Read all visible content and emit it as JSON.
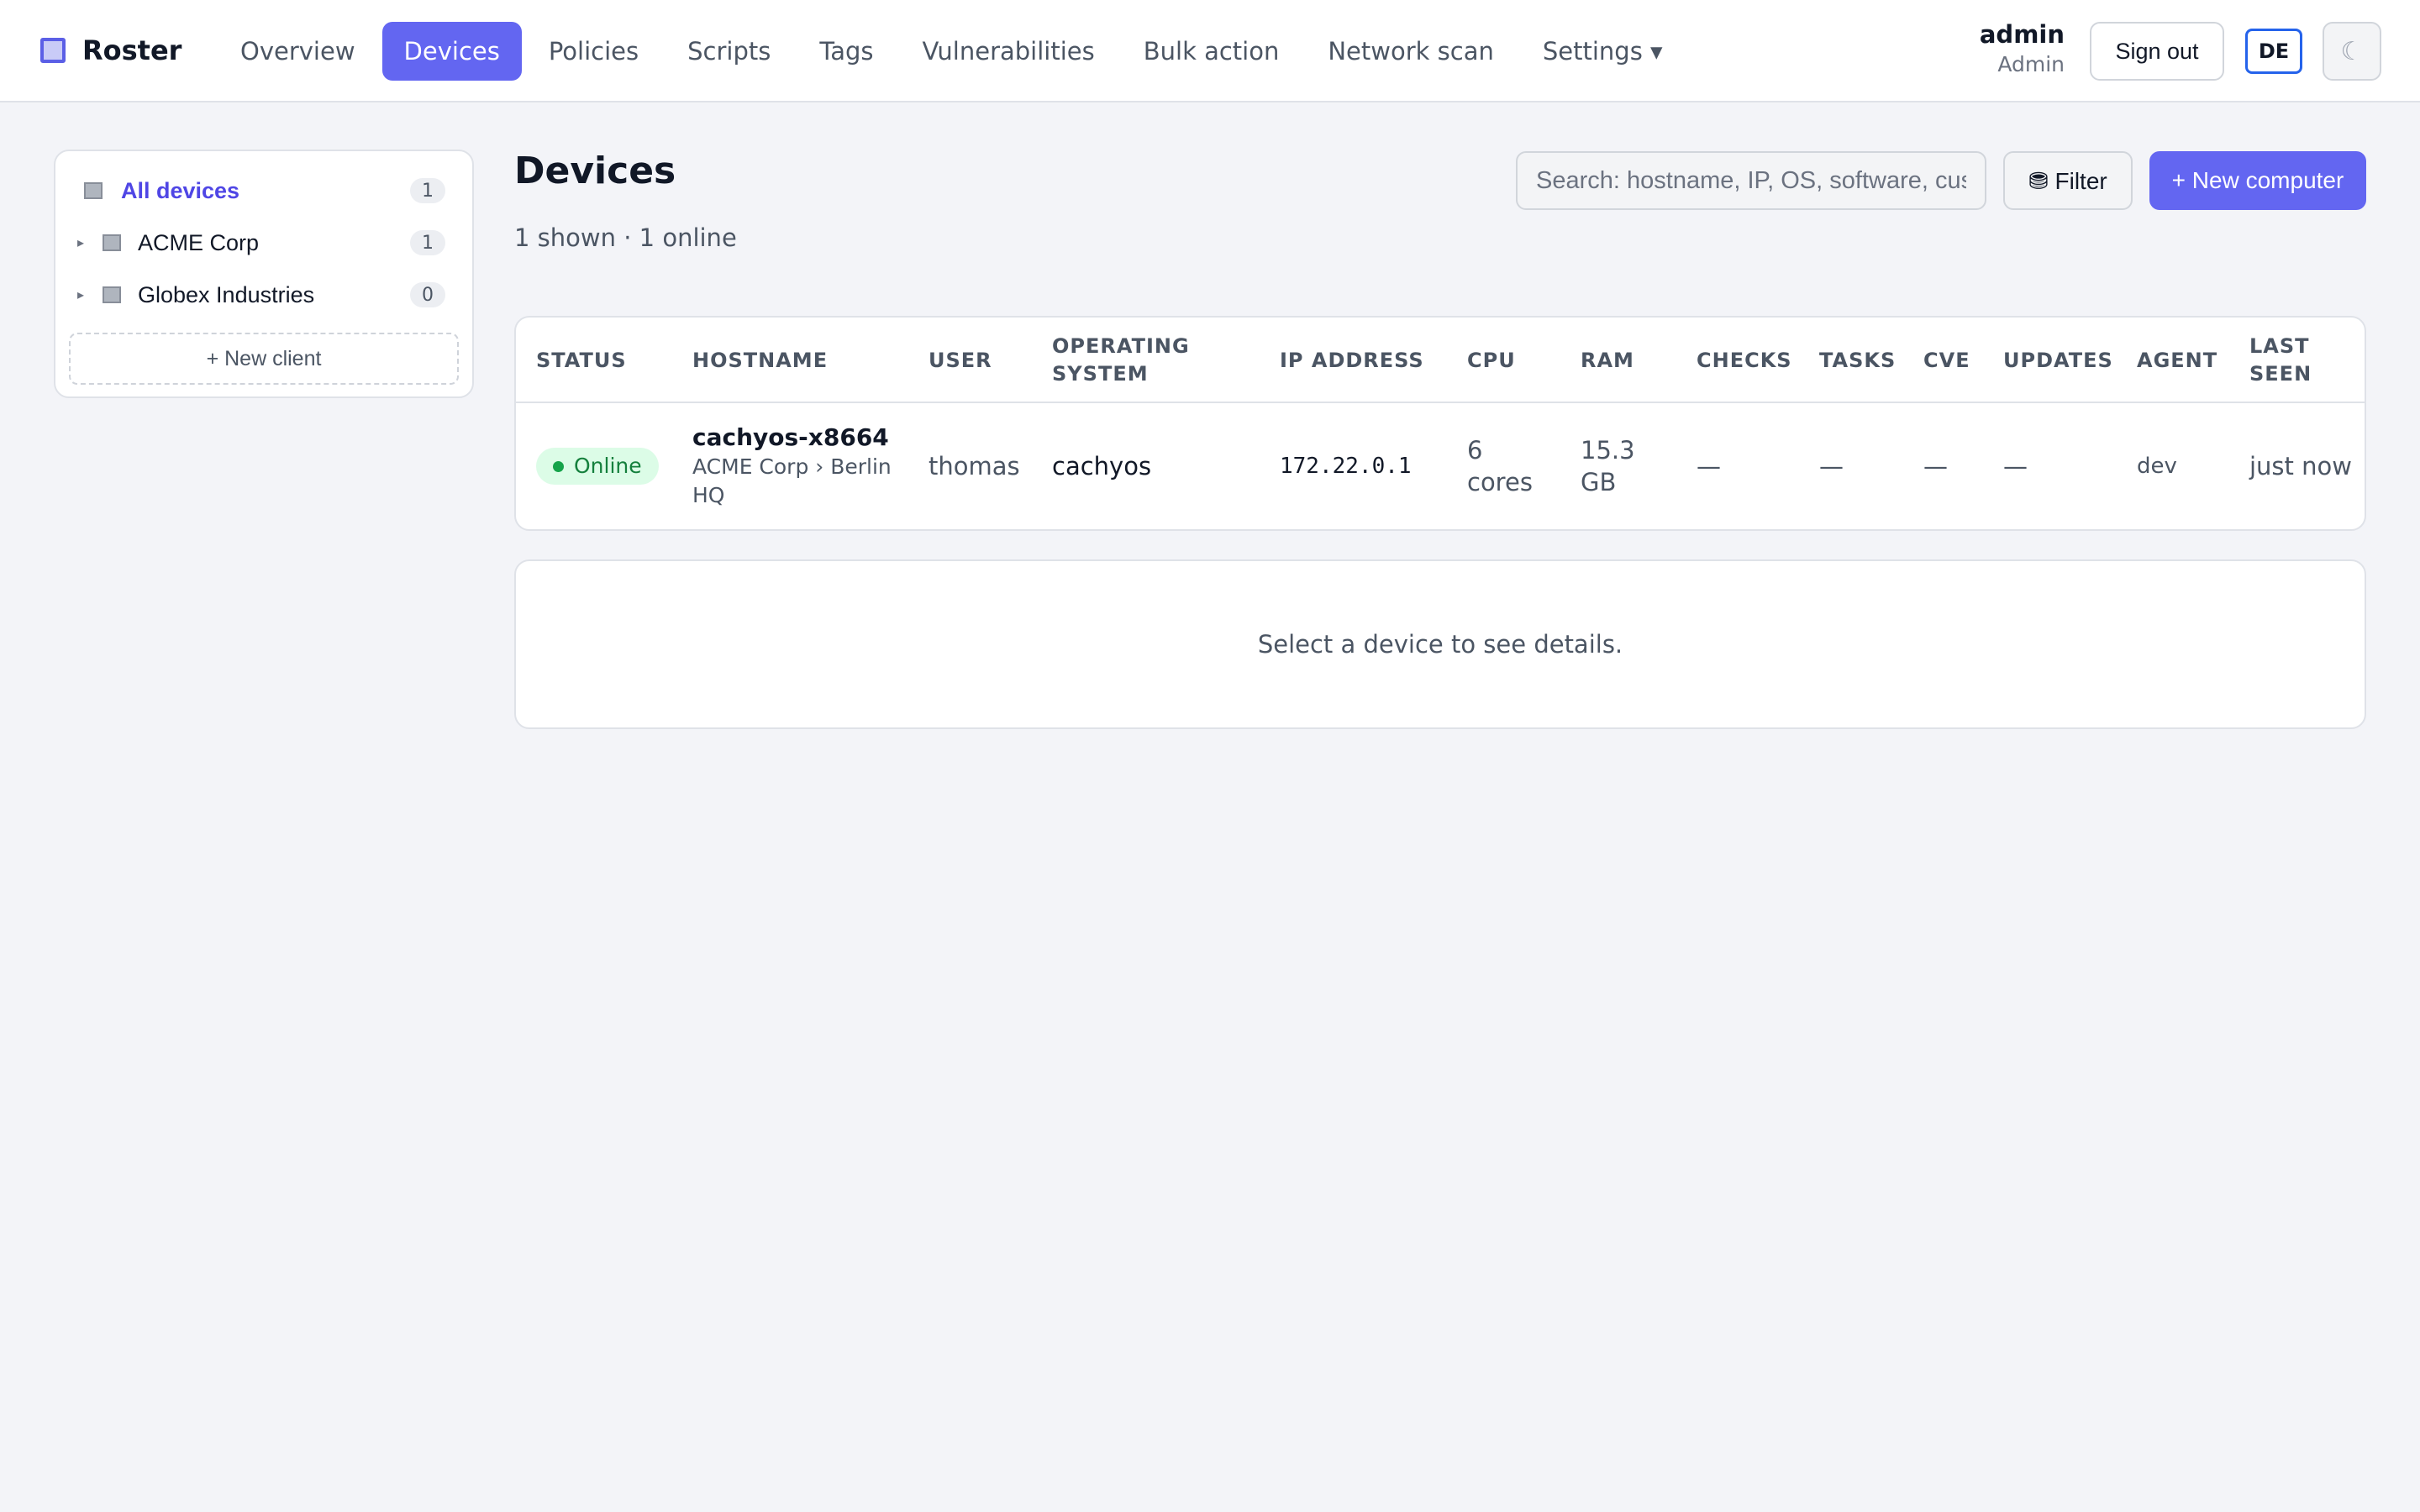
{
  "app": {
    "name": "Roster",
    "logo_icon": "square-app-icon",
    "accent": "#6366f1"
  },
  "nav": {
    "items": [
      {
        "label": "Overview",
        "active": false
      },
      {
        "label": "Devices",
        "active": true
      },
      {
        "label": "Policies",
        "active": false
      },
      {
        "label": "Scripts",
        "active": false
      },
      {
        "label": "Tags",
        "active": false
      },
      {
        "label": "Vulnerabilities",
        "active": false
      },
      {
        "label": "Bulk action",
        "active": false
      },
      {
        "label": "Network scan",
        "active": false
      },
      {
        "label": "Settings ▾",
        "active": false
      }
    ]
  },
  "user": {
    "name": "admin",
    "role": "Admin",
    "signout_label": "Sign out",
    "language": "DE",
    "theme_icon": "☾"
  },
  "sidebar": {
    "all": {
      "label": "All devices",
      "count": "1"
    },
    "clients": [
      {
        "label": "ACME Corp",
        "count": "1"
      },
      {
        "label": "Globex Industries",
        "count": "0"
      }
    ],
    "new_client_label": "+ New client"
  },
  "page": {
    "title": "Devices",
    "subtitle": "1 shown · 1 online",
    "search_placeholder": "Search: hostname, IP, OS, software, cust",
    "filter_label": "⛃ Filter",
    "new_label": "+ New computer"
  },
  "table": {
    "headers": [
      "STATUS",
      "HOSTNAME",
      "USER",
      "OPERATING SYSTEM",
      "IP ADDRESS",
      "CPU",
      "RAM",
      "CHECKS",
      "TASKS",
      "CVE",
      "UPDATES",
      "AGENT",
      "LAST SEEN"
    ],
    "rows": [
      {
        "status": "Online",
        "hostname": "cachyos-x8664",
        "location": "ACME Corp › Berlin HQ",
        "user": "thomas",
        "os": "cachyos",
        "ip": "172.22.0.1",
        "cpu": "6 cores",
        "ram": "15.3 GB",
        "checks": "—",
        "tasks": "—",
        "cve": "—",
        "updates": "—",
        "agent": "dev",
        "last_seen": "just now"
      }
    ]
  },
  "detail": {
    "empty_text": "Select a device to see details."
  }
}
